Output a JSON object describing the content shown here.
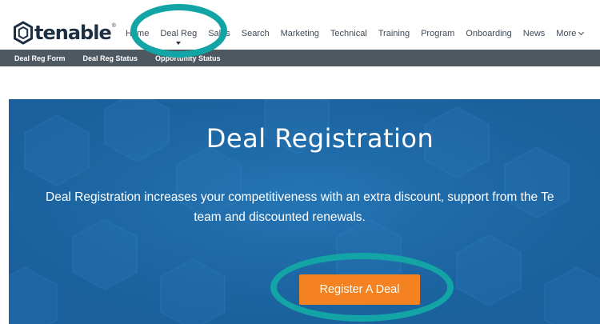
{
  "brand": {
    "name": "tenable",
    "tm": "®"
  },
  "nav": {
    "items": [
      {
        "label": "Home"
      },
      {
        "label": "Deal Reg"
      },
      {
        "label": "Sales"
      },
      {
        "label": "Search"
      },
      {
        "label": "Marketing"
      },
      {
        "label": "Technical"
      },
      {
        "label": "Training"
      },
      {
        "label": "Program"
      },
      {
        "label": "Onboarding"
      },
      {
        "label": "News"
      },
      {
        "label": "More"
      }
    ]
  },
  "subnav": {
    "items": [
      {
        "label": "Deal Reg Form"
      },
      {
        "label": "Deal Reg Status"
      },
      {
        "label": "Opportunity Status"
      }
    ]
  },
  "hero": {
    "title": "Deal Registration",
    "text_line1": "Deal Registration increases your competitiveness with an extra discount, support from the Te",
    "text_line2": "team and discounted renewals.",
    "cta_label": "Register A Deal"
  },
  "colors": {
    "nav_text": "#3f4b58",
    "subnav_bg": "#4e5861",
    "hero_bg": "#1d6aa8",
    "cta_bg": "#f58220",
    "annotation": "#13a5a5"
  }
}
